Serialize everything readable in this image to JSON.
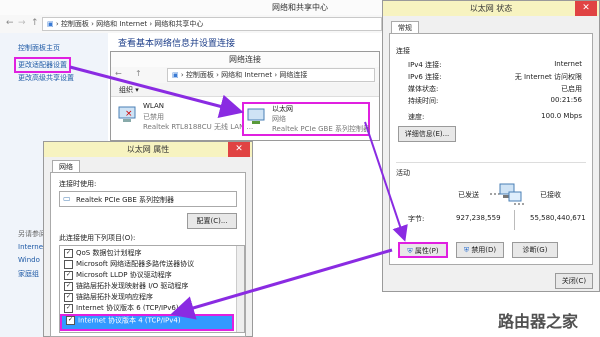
{
  "main_window": {
    "title": "网络和共享中心",
    "address": [
      "控制面板",
      "网络和 Internet",
      "网络和共享中心"
    ],
    "sidebar": {
      "home": "控制面板主页",
      "change_adapter": "更改适配器设置",
      "change_sharing": "更改高级共享设置",
      "see_also_title": "另请参阅",
      "see_also": [
        "Internet",
        "Windo",
        "家庭组"
      ]
    },
    "heading": "查看基本网络信息并设置连接"
  },
  "net_window": {
    "title": "网络连接",
    "address": [
      "控制面板",
      "网络和 Internet",
      "网络连接"
    ],
    "organize": "组织 ▾",
    "adapters": [
      {
        "name": "WLAN",
        "status": "已禁用",
        "device": "Realtek RTL8188CU 无线 LAN ..."
      },
      {
        "name": "以太网",
        "status": "网络",
        "device": "Realtek PCIe GBE 系列控制器"
      }
    ]
  },
  "props_dialog": {
    "title": "以太网 属性",
    "tab": "网络",
    "connect_using_label": "连接时使用:",
    "adapter_name": "Realtek PCIe GBE 系列控制器",
    "configure_button": "配置(C)...",
    "items_label": "此连接使用下列项目(O):",
    "items": [
      {
        "label": "QoS 数据包计划程序",
        "checked": true,
        "selected": false
      },
      {
        "label": "Microsoft 网络适配器多路传送器协议",
        "checked": false,
        "selected": false
      },
      {
        "label": "Microsoft LLDP 协议驱动程序",
        "checked": true,
        "selected": false
      },
      {
        "label": "链路层拓扑发现映射器 I/O 驱动程序",
        "checked": true,
        "selected": false
      },
      {
        "label": "链路层拓扑发现响应程序",
        "checked": true,
        "selected": false
      },
      {
        "label": "Internet 协议版本 6 (TCP/IPv6)",
        "checked": true,
        "selected": false
      },
      {
        "label": "Internet 协议版本 4 (TCP/IPv4)",
        "checked": true,
        "selected": true
      }
    ]
  },
  "status_dialog": {
    "title": "以太网 状态",
    "tab": "常规",
    "connection_label": "连接",
    "rows": [
      {
        "label": "IPv4 连接:",
        "value": "Internet"
      },
      {
        "label": "IPv6 连接:",
        "value": "无 Internet 访问权限"
      },
      {
        "label": "媒体状态:",
        "value": "已启用"
      },
      {
        "label": "持续时间:",
        "value": "00:21:56"
      },
      {
        "label": "速度:",
        "value": "100.0 Mbps"
      }
    ],
    "details_button": "详细信息(E)...",
    "activity_label": "活动",
    "sent_label": "已发送",
    "received_label": "已接收",
    "bytes_label": "字节:",
    "bytes_sent": "927,238,559",
    "bytes_received": "55,580,440,671",
    "properties_button": "属性(P)",
    "disable_button": "禁用(D)",
    "diagnose_button": "诊断(G)",
    "close_button": "关闭(C)"
  },
  "watermark": "路由器之家",
  "colors": {
    "accent": "#e020e0",
    "arrow": "#8a2be2",
    "link": "#1f5aa6",
    "selection": "#3399ff"
  }
}
